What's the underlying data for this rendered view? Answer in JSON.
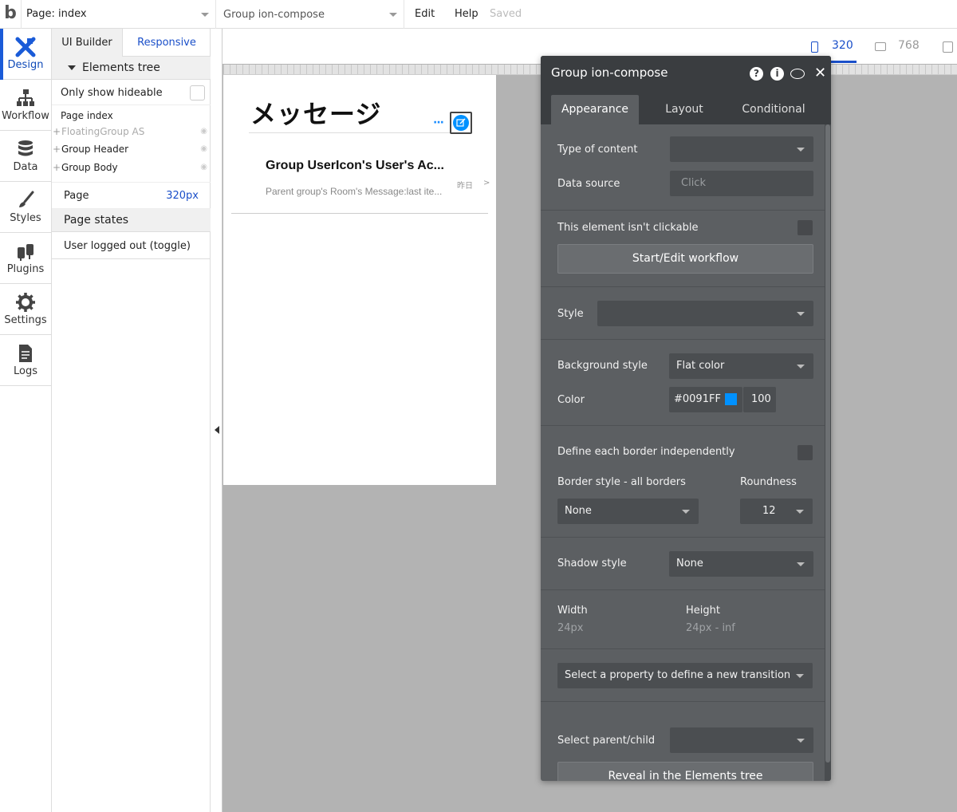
{
  "topbar": {
    "logo": "b",
    "page_select": "Page: index",
    "group_select": "Group ion-compose",
    "menu_edit": "Edit",
    "menu_help": "Help",
    "status": "Saved"
  },
  "sidebar": {
    "items": [
      {
        "label": "Design",
        "icon": "design-icon"
      },
      {
        "label": "Workflow",
        "icon": "workflow-icon"
      },
      {
        "label": "Data",
        "icon": "database-icon"
      },
      {
        "label": "Styles",
        "icon": "brush-icon"
      },
      {
        "label": "Plugins",
        "icon": "plug-icon"
      },
      {
        "label": "Settings",
        "icon": "gear-icon"
      },
      {
        "label": "Logs",
        "icon": "document-icon"
      }
    ]
  },
  "left_panel": {
    "tab_ui": "UI Builder",
    "tab_responsive": "Responsive",
    "elements_tree": "Elements tree",
    "only_hideable": "Only show hideable",
    "tree": [
      {
        "label": "Page index"
      },
      {
        "label": "FloatingGroup AS"
      },
      {
        "label": "Group Header"
      },
      {
        "label": "Group Body"
      }
    ],
    "page_label": "Page",
    "page_value": "320px",
    "page_states": "Page states",
    "user_logged_out": "User logged out (toggle)"
  },
  "viewport": {
    "mobile": "320",
    "tablet": "768"
  },
  "page_preview": {
    "title": "メッセージ",
    "dots": "···",
    "user_name": "Group UserIcon's User's Ac...",
    "message": "Parent group's Room's Message:last ite...",
    "date": "昨日",
    "chevron": ">"
  },
  "property_editor": {
    "title": "Group ion-compose",
    "tabs": [
      "Appearance",
      "Layout",
      "Conditional"
    ],
    "type_of_content_label": "Type of content",
    "data_source_label": "Data source",
    "data_source_placeholder": "Click",
    "not_clickable_label": "This element isn't clickable",
    "workflow_button": "Start/Edit workflow",
    "style_label": "Style",
    "bg_style_label": "Background style",
    "bg_style_value": "Flat color",
    "color_label": "Color",
    "color_value": "#0091FF",
    "color_hex": "#0091FF",
    "opacity_value": "100",
    "border_independent_label": "Define each border independently",
    "border_style_label": "Border style - all borders",
    "border_style_value": "None",
    "roundness_label": "Roundness",
    "roundness_value": "12",
    "shadow_label": "Shadow style",
    "shadow_value": "None",
    "width_label": "Width",
    "width_value": "24px",
    "height_label": "Height",
    "height_value": "24px - inf",
    "transition_select": "Select a property to define a new transition",
    "parent_child_label": "Select parent/child",
    "reveal_button": "Reveal in the Elements tree"
  }
}
